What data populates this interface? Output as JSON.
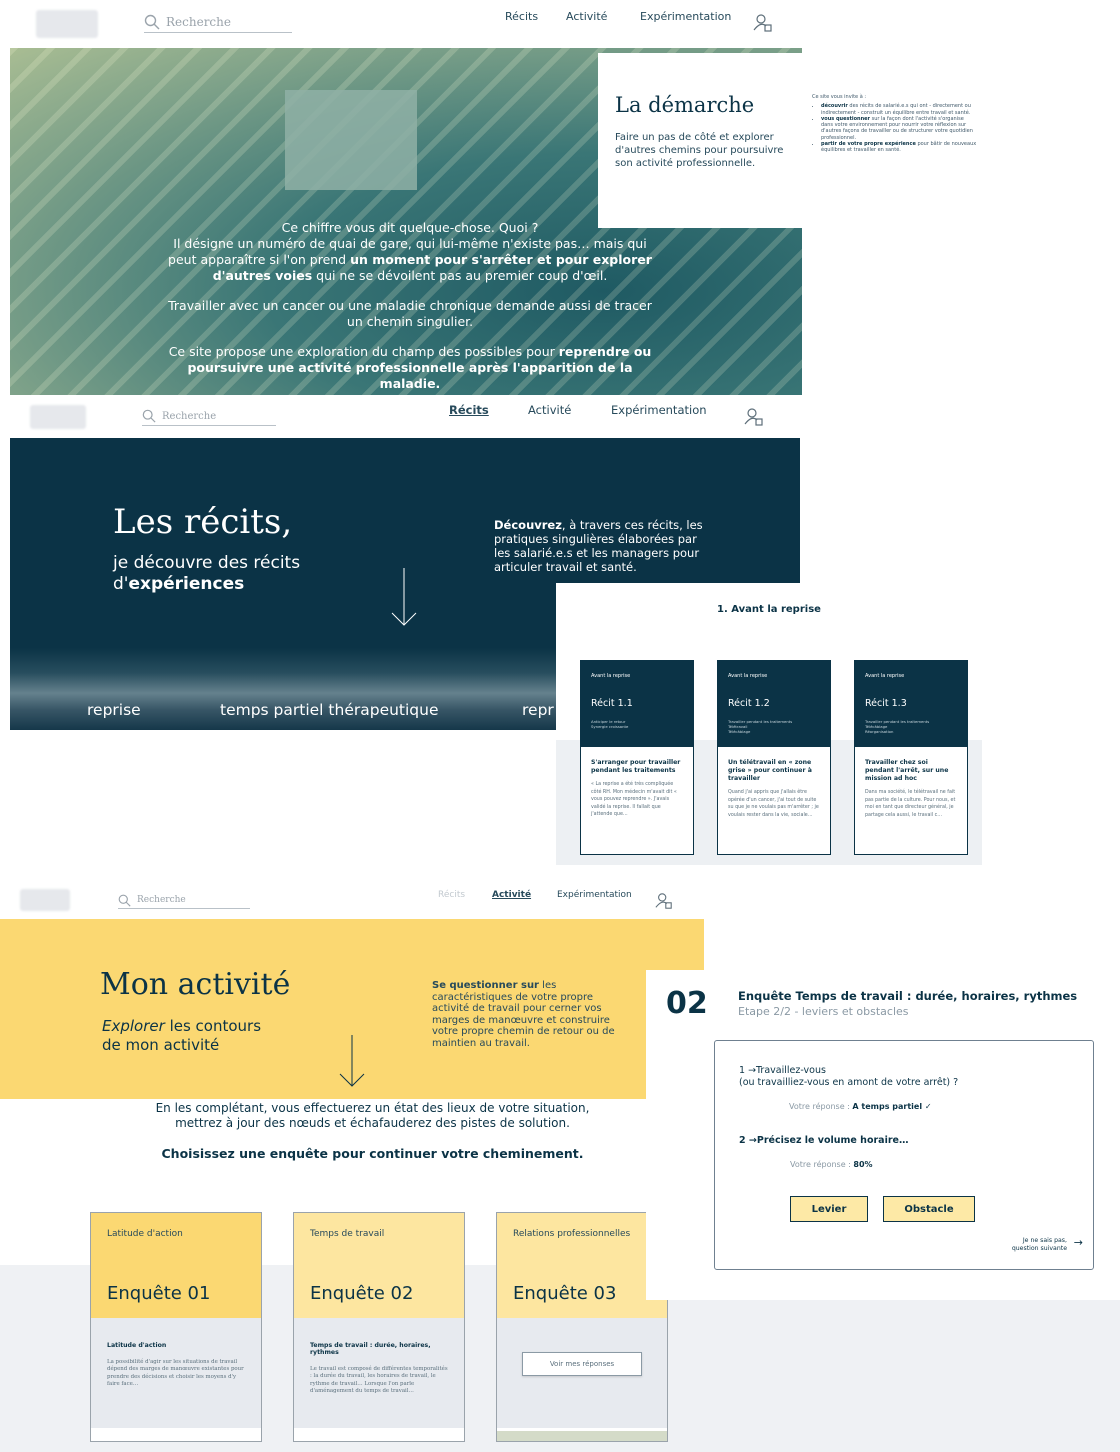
{
  "nav": {
    "search_placeholder": "Recherche",
    "links": [
      "Récits",
      "Activité",
      "Expérimentation"
    ]
  },
  "demarche": {
    "title": "La démarche",
    "text": "Faire un pas de côté et explorer d'autres chemins pour poursuivre son activité professionnelle.",
    "invite_title": "Ce site vous invite à :",
    "invite_items": [
      {
        "bold": "découvrir",
        "text": " des récits de salarié.e.s qui ont - directement ou indirectement - construit un équilibre entre travail et santé."
      },
      {
        "bold": "vous questionner",
        "text": " sur la façon dont l'activité s'organise dans votre environnement pour nourrir votre réflexion sur d'autres façons de travailler ou de structurer votre quotidien professionnel."
      },
      {
        "bold": "partir de votre propre expérience",
        "text": " pour bâtir de nouveaux équilibres et travailler en santé."
      }
    ]
  },
  "hero": {
    "p1_a": "Ce chiffre vous dit quelque-chose. Quoi ?",
    "p1_b": "Il désigne un numéro de quai de gare, qui lui-même n'existe pas… mais qui peut apparaître si l'on prend ",
    "p1_bold": "un moment pour s'arrêter et pour explorer d'autres voies",
    "p1_c": " qui ne se dévoilent pas au premier coup d'œil.",
    "p2": "Travailler avec un cancer ou une maladie chronique demande aussi de tracer un chemin singulier.",
    "p3_a": "Ce site propose une exploration du champ des possibles pour ",
    "p3_bold": "reprendre ou poursuivre une activité professionnelle après l'apparition de la maladie."
  },
  "recits": {
    "title": "Les récits,",
    "sub_a": "je découvre des récits",
    "sub_b": "d'",
    "sub_bold": "expériences",
    "desc_bold": "Découvrez",
    "desc": ", à travers ces récits, les pratiques singulières élaborées par les salarié.e.s et les managers pour articuler travail et santé.",
    "ticker": [
      "reprise",
      "temps partiel thérapeutique",
      "repr"
    ]
  },
  "avant": {
    "title": "1. Avant la reprise",
    "cards": [
      {
        "section": "Avant la reprise",
        "name": "Récit 1.1",
        "tags": [
          "Anticiper le retour",
          "Synergie croissante"
        ],
        "headline": "S'arranger pour travailler pendant les traitements",
        "excerpt": "« La reprise a été très compliquée côté RH. Mon médecin m'avait dit « vous pouvez reprendre ». J'avais validé la reprise. Il fallait que j'attende que…"
      },
      {
        "section": "Avant la reprise",
        "name": "Récit 1.2",
        "tags": [
          "Travailler pendant les traitements",
          "Télétravail",
          "Télécâblage"
        ],
        "headline": "Un télétravail en « zone grise » pour continuer à travailler",
        "excerpt": "Quand j'ai appris que j'allais être opérée d'un cancer, j'ai tout de suite su que je ne voulais pas m'arrêter ; je voulais rester dans la vie, sociale…"
      },
      {
        "section": "Avant la reprise",
        "name": "Récit 1.3",
        "tags": [
          "Travailler pendant les traitements",
          "Télécâblage",
          "Réorganisation"
        ],
        "headline": "Travailler chez soi pendant l'arrêt, sur une mission ad hoc",
        "excerpt": "Dans ma société, le télétravail ne fait pas partie de la culture. Pour nous, et moi en tant que directeur général, je partage cela aussi, le travail c…"
      }
    ]
  },
  "activite": {
    "title": "Mon activité",
    "sub_italic": "Explorer",
    "sub_a": " les contours",
    "sub_b": "de mon activité",
    "desc_bold": "Se questionner sur",
    "desc": " les caractéristiques de votre propre activité de travail pour cerner vos marges de manœuvre et construire votre propre chemin de retour ou de maintien au travail.",
    "intro": "En les complétant, vous effectuerez un état des lieux de votre situation, mettrez à jour des nœuds et échafauderez des pistes de solution.",
    "choose": "Choisissez une enquête pour continuer votre cheminement.",
    "cards": [
      {
        "category": "Latitude d'action",
        "name": "Enquête 01",
        "color": "#fbd872",
        "sub": "Latitude d'action",
        "text": "La possibilité d'agir sur les situations de travail dépend des marges de manœuvre existantes pour prendre des décisions et choisir les moyens d'y faire face…"
      },
      {
        "category": "Temps de travail",
        "name": "Enquête 02",
        "color": "#fde6a0",
        "sub": "Temps de travail : durée, horaires, rythmes",
        "text": "Le travail est composé de différentes temporalités : la durée du travail, les horaires de travail, le rythme de travail… Lorsque l'on parle d'aménagement du temps de travail…"
      },
      {
        "category": "Relations professionnelles",
        "name": "Enquête 03",
        "color": "#fde6a0",
        "button": "Voir mes réponses"
      }
    ]
  },
  "enquete": {
    "number": "02",
    "title": "Enquête Temps de travail : durée, horaires, rythmes",
    "step": "Etape 2/2 - leviers et obstacles",
    "q1_a": "1 →Travaillez-vous",
    "q1_b": "(ou travailliez-vous en amont de votre arrêt) ?",
    "a1_label": "Votre réponse :",
    "a1": "A temps partiel ✓",
    "q2": "2 →Précisez le volume horaire…",
    "a2_label": "Votre réponse :",
    "a2": "80%",
    "btn_levier": "Levier",
    "btn_obstacle": "Obstacle",
    "skip_a": "Je ne sais pas,",
    "skip_b": "question suivante",
    "skip_arrow": "→"
  },
  "colors": {
    "navy": "#0b3346",
    "yellow": "#fbd872",
    "lightyellow": "#fde9a6"
  }
}
